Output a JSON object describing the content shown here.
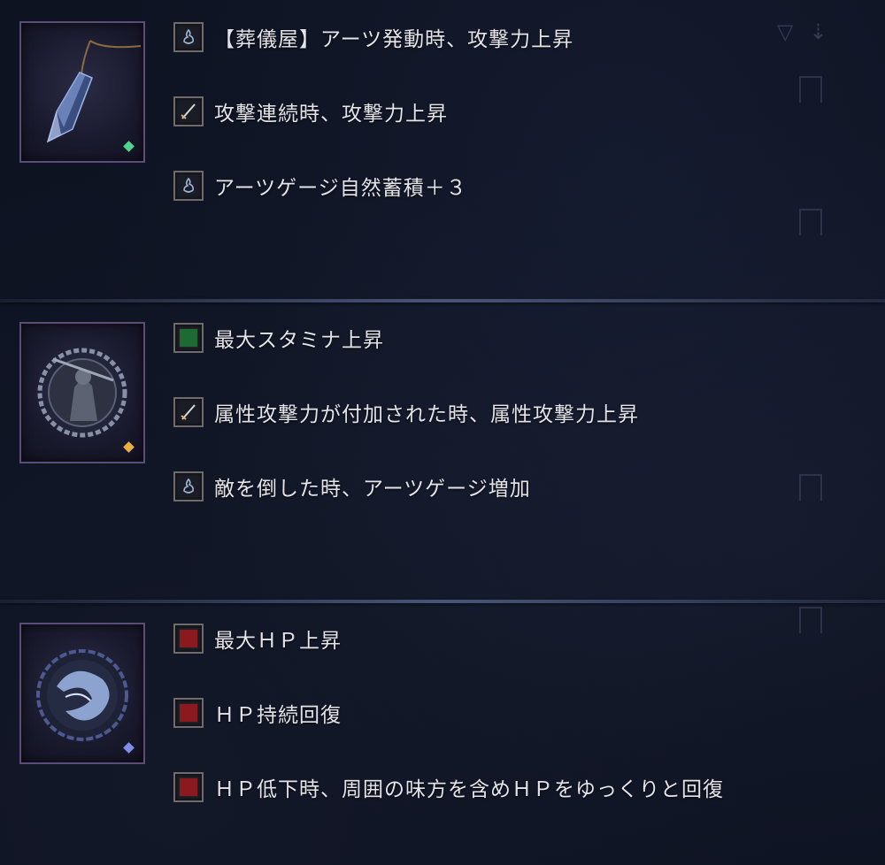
{
  "relics": [
    {
      "relic_icon": "pendant-crystal-icon",
      "gem_color": "#4fd38f",
      "effects": [
        {
          "icon": "flame-icon",
          "text": "【葬儀屋】アーツ発動時、攻撃力上昇"
        },
        {
          "icon": "sword-icon",
          "text": "攻撃連続時、攻撃力上昇"
        },
        {
          "icon": "flame-icon",
          "text": "アーツゲージ自然蓄積＋３"
        }
      ]
    },
    {
      "relic_icon": "warrior-medallion-icon",
      "gem_color": "#e8b040",
      "effects": [
        {
          "icon": "green-square-icon",
          "text": "最大スタミナ上昇"
        },
        {
          "icon": "sword-icon",
          "text": "属性攻撃力が付加された時、属性攻撃力上昇"
        },
        {
          "icon": "flame-icon",
          "text": "敵を倒した時、アーツゲージ増加"
        }
      ]
    },
    {
      "relic_icon": "blue-serpent-orb-icon",
      "gem_color": "#7f8fe8",
      "effects": [
        {
          "icon": "red-square-icon",
          "text": "最大ＨＰ上昇"
        },
        {
          "icon": "red-square-icon",
          "text": "ＨＰ持続回復"
        },
        {
          "icon": "red-square-icon",
          "text": "ＨＰ低下時、周囲の味方を含めＨＰをゆっくりと回復"
        }
      ]
    }
  ],
  "colors": {
    "background": "#0e1322",
    "hp_red": "#8a1a1f",
    "stamina_green": "#1e6a35"
  }
}
